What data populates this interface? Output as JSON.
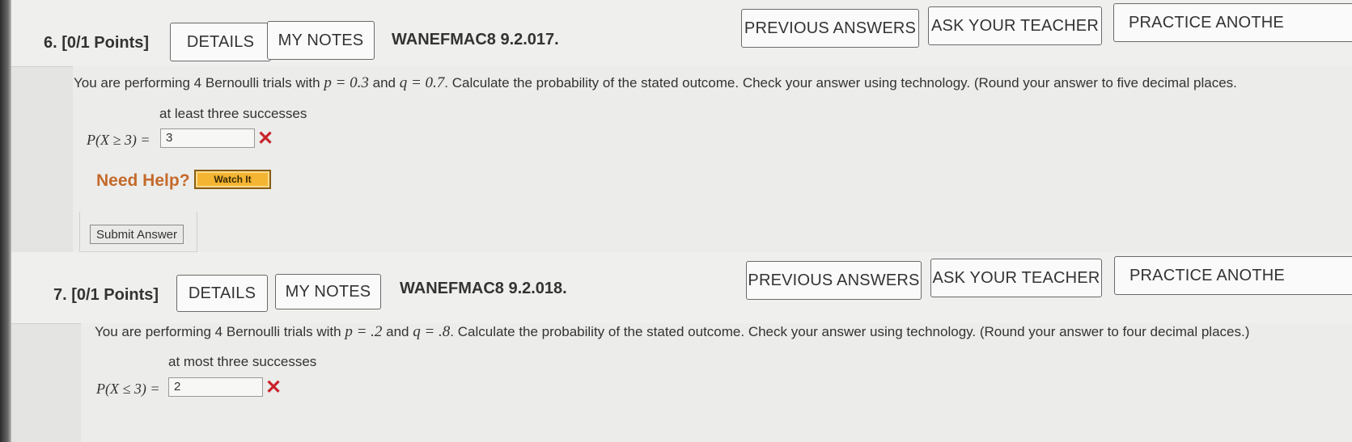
{
  "questions": [
    {
      "number": "6.",
      "points": "[0/1 Points]",
      "details_label": "DETAILS",
      "notes_label": "MY NOTES",
      "code": "WANEFMAC8 9.2.017.",
      "previous_label": "PREVIOUS ANSWERS",
      "ask_label": "ASK YOUR TEACHER",
      "practice_label": "PRACTICE ANOTHE",
      "prompt_start": "You are performing 4 Bernoulli trials with ",
      "p_value": "p = 0.3",
      "and_text": " and ",
      "q_value": "q = 0.7",
      "prompt_end": ". Calculate the probability of the stated outcome. Check your answer using technology. (Round your answer to five decimal places.",
      "subprompt": "at least three successes",
      "prob_expr": "P(X ≥ 3) =",
      "answer": "3",
      "status_icon": "x-mark-icon",
      "need_help": "Need Help?",
      "watch_label": "Watch It",
      "submit_label": "Submit Answer"
    },
    {
      "number": "7.",
      "points": "[0/1 Points]",
      "details_label": "DETAILS",
      "notes_label": "MY NOTES",
      "code": "WANEFMAC8 9.2.018.",
      "previous_label": "PREVIOUS ANSWERS",
      "ask_label": "ASK YOUR TEACHER",
      "practice_label": "PRACTICE ANOTHE",
      "prompt_start": "You are performing 4 Bernoulli trials with ",
      "p_value": "p = .2",
      "and_text": " and ",
      "q_value": "q = .8",
      "prompt_end": ". Calculate the probability of the stated outcome. Check your answer using technology. (Round your answer to four decimal places.)",
      "subprompt": "at most three successes",
      "prob_expr": "P(X ≤ 3) =",
      "answer": "2",
      "status_icon": "x-mark-icon"
    }
  ],
  "colors": {
    "incorrect": "#c8232c",
    "need_help": "#c46a2b",
    "watch_button": "#f4b533"
  }
}
